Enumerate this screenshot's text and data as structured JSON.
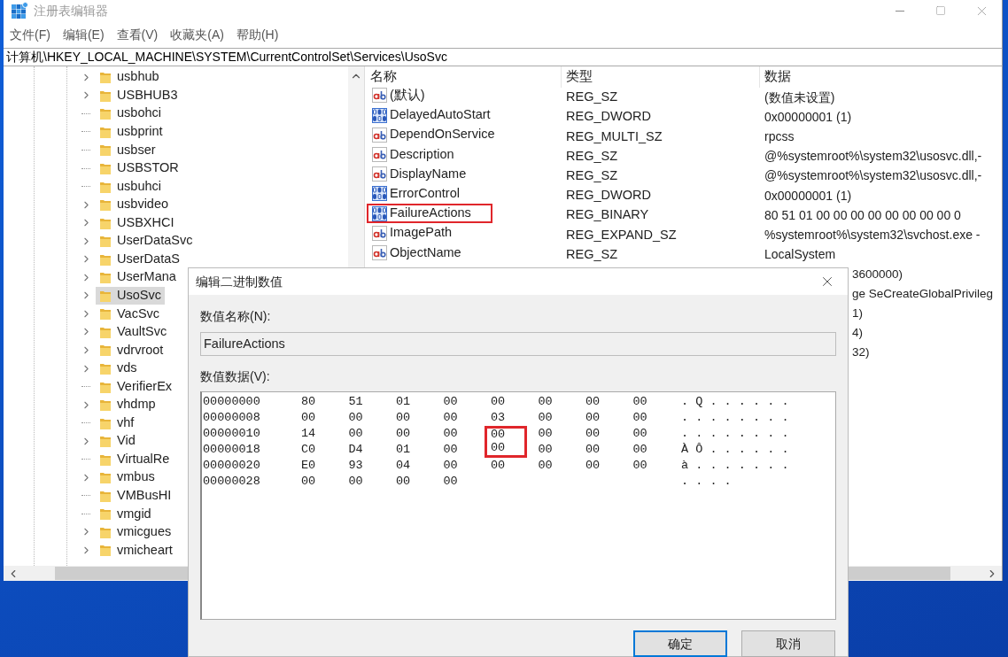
{
  "window": {
    "title": "注册表编辑器"
  },
  "menu": [
    "文件(F)",
    "编辑(E)",
    "查看(V)",
    "收藏夹(A)",
    "帮助(H)"
  ],
  "address": "计算机\\HKEY_LOCAL_MACHINE\\SYSTEM\\CurrentControlSet\\Services\\UsoSvc",
  "tree": {
    "items": [
      {
        "label": "usbhub",
        "expandable": true,
        "selected": false
      },
      {
        "label": "USBHUB3",
        "expandable": true,
        "selected": false
      },
      {
        "label": "usbohci",
        "expandable": false,
        "selected": false
      },
      {
        "label": "usbprint",
        "expandable": false,
        "selected": false
      },
      {
        "label": "usbser",
        "expandable": false,
        "selected": false
      },
      {
        "label": "USBSTOR",
        "expandable": false,
        "selected": false
      },
      {
        "label": "usbuhci",
        "expandable": false,
        "selected": false
      },
      {
        "label": "usbvideo",
        "expandable": true,
        "selected": false
      },
      {
        "label": "USBXHCI",
        "expandable": true,
        "selected": false
      },
      {
        "label": "UserDataSvc",
        "expandable": true,
        "selected": false
      },
      {
        "label": "UserDataS",
        "expandable": true,
        "selected": false
      },
      {
        "label": "UserMana",
        "expandable": true,
        "selected": false
      },
      {
        "label": "UsoSvc",
        "expandable": true,
        "selected": true
      },
      {
        "label": "VacSvc",
        "expandable": true,
        "selected": false
      },
      {
        "label": "VaultSvc",
        "expandable": true,
        "selected": false
      },
      {
        "label": "vdrvroot",
        "expandable": true,
        "selected": false
      },
      {
        "label": "vds",
        "expandable": true,
        "selected": false
      },
      {
        "label": "VerifierEx",
        "expandable": false,
        "selected": false
      },
      {
        "label": "vhdmp",
        "expandable": true,
        "selected": false
      },
      {
        "label": "vhf",
        "expandable": false,
        "selected": false
      },
      {
        "label": "Vid",
        "expandable": true,
        "selected": false
      },
      {
        "label": "VirtualRe",
        "expandable": false,
        "selected": false
      },
      {
        "label": "vmbus",
        "expandable": true,
        "selected": false
      },
      {
        "label": "VMBusHI",
        "expandable": false,
        "selected": false
      },
      {
        "label": "vmgid",
        "expandable": false,
        "selected": false
      },
      {
        "label": "vmicgues",
        "expandable": true,
        "selected": false
      },
      {
        "label": "vmicheart",
        "expandable": true,
        "selected": false
      }
    ]
  },
  "values": {
    "columns": [
      "名称",
      "类型",
      "数据"
    ],
    "rows": [
      {
        "kind": "string",
        "name": "(默认)",
        "type": "REG_SZ",
        "data": "(数值未设置)",
        "marked": false
      },
      {
        "kind": "binary",
        "name": "DelayedAutoStart",
        "type": "REG_DWORD",
        "data": "0x00000001 (1)",
        "marked": false
      },
      {
        "kind": "string",
        "name": "DependOnService",
        "type": "REG_MULTI_SZ",
        "data": "rpcss",
        "marked": false
      },
      {
        "kind": "string",
        "name": "Description",
        "type": "REG_SZ",
        "data": "@%systemroot%\\system32\\usosvc.dll,-",
        "marked": false
      },
      {
        "kind": "string",
        "name": "DisplayName",
        "type": "REG_SZ",
        "data": "@%systemroot%\\system32\\usosvc.dll,-",
        "marked": false
      },
      {
        "kind": "binary",
        "name": "ErrorControl",
        "type": "REG_DWORD",
        "data": "0x00000001 (1)",
        "marked": false
      },
      {
        "kind": "binary",
        "name": "FailureActions",
        "type": "REG_BINARY",
        "data": "80 51 01 00 00 00 00 00 00 00 00 0",
        "marked": true
      },
      {
        "kind": "string",
        "name": "ImagePath",
        "type": "REG_EXPAND_SZ",
        "data": "%systemroot%\\system32\\svchost.exe -",
        "marked": false
      },
      {
        "kind": "string",
        "name": "ObjectName",
        "type": "REG_SZ",
        "data": "LocalSystem",
        "marked": false
      }
    ],
    "data_fragments": [
      "3600000)",
      "ge SeCreateGlobalPrivileg",
      "1)",
      "4)",
      "32)"
    ]
  },
  "dialog": {
    "title": "编辑二进制数值",
    "name_label": "数值名称(N):",
    "name_value": "FailureActions",
    "data_label": "数值数据(V):",
    "hex_rows": [
      {
        "address": "00000000",
        "bytes": [
          {
            "value": "80",
            "marked": false
          },
          {
            "value": "51",
            "marked": false
          },
          {
            "value": "01",
            "marked": false
          },
          {
            "value": "00",
            "marked": false
          },
          {
            "value": "00",
            "marked": false
          },
          {
            "value": "00",
            "marked": false
          },
          {
            "value": "00",
            "marked": false
          },
          {
            "value": "00",
            "marked": false
          }
        ],
        "ascii": ". Q . . . . . ."
      },
      {
        "address": "00000008",
        "bytes": [
          {
            "value": "00",
            "marked": false
          },
          {
            "value": "00",
            "marked": false
          },
          {
            "value": "00",
            "marked": false
          },
          {
            "value": "00",
            "marked": false
          },
          {
            "value": "03",
            "marked": false
          },
          {
            "value": "00",
            "marked": false
          },
          {
            "value": "00",
            "marked": false
          },
          {
            "value": "00",
            "marked": false
          }
        ],
        "ascii": ". . . . . . . ."
      },
      {
        "address": "00000010",
        "bytes": [
          {
            "value": "14",
            "marked": false
          },
          {
            "value": "00",
            "marked": false
          },
          {
            "value": "00",
            "marked": false
          },
          {
            "value": "00",
            "marked": false
          },
          {
            "value": "00",
            "marked": true
          },
          {
            "value": "00",
            "marked": false
          },
          {
            "value": "00",
            "marked": false
          },
          {
            "value": "00",
            "marked": false
          }
        ],
        "ascii": ". . . . . . . ."
      },
      {
        "address": "00000018",
        "bytes": [
          {
            "value": "C0",
            "marked": false
          },
          {
            "value": "D4",
            "marked": false
          },
          {
            "value": "01",
            "marked": false
          },
          {
            "value": "00",
            "marked": false
          },
          {
            "value": "00",
            "marked": true
          },
          {
            "value": "00",
            "marked": false
          },
          {
            "value": "00",
            "marked": false
          },
          {
            "value": "00",
            "marked": false
          }
        ],
        "ascii": "À Ô . . . . . ."
      },
      {
        "address": "00000020",
        "bytes": [
          {
            "value": "E0",
            "marked": false
          },
          {
            "value": "93",
            "marked": false
          },
          {
            "value": "04",
            "marked": false
          },
          {
            "value": "00",
            "marked": false
          },
          {
            "value": "00",
            "marked": false
          },
          {
            "value": "00",
            "marked": false
          },
          {
            "value": "00",
            "marked": false
          },
          {
            "value": "00",
            "marked": false
          }
        ],
        "ascii": "à . . . . . . ."
      },
      {
        "address": "00000028",
        "bytes": [
          {
            "value": "00",
            "marked": false
          },
          {
            "value": "00",
            "marked": false
          },
          {
            "value": "00",
            "marked": false
          },
          {
            "value": "00",
            "marked": false
          }
        ],
        "ascii": ". . . ."
      }
    ],
    "buttons": [
      {
        "label": "确定",
        "default": true
      },
      {
        "label": "取消",
        "default": false
      }
    ]
  }
}
